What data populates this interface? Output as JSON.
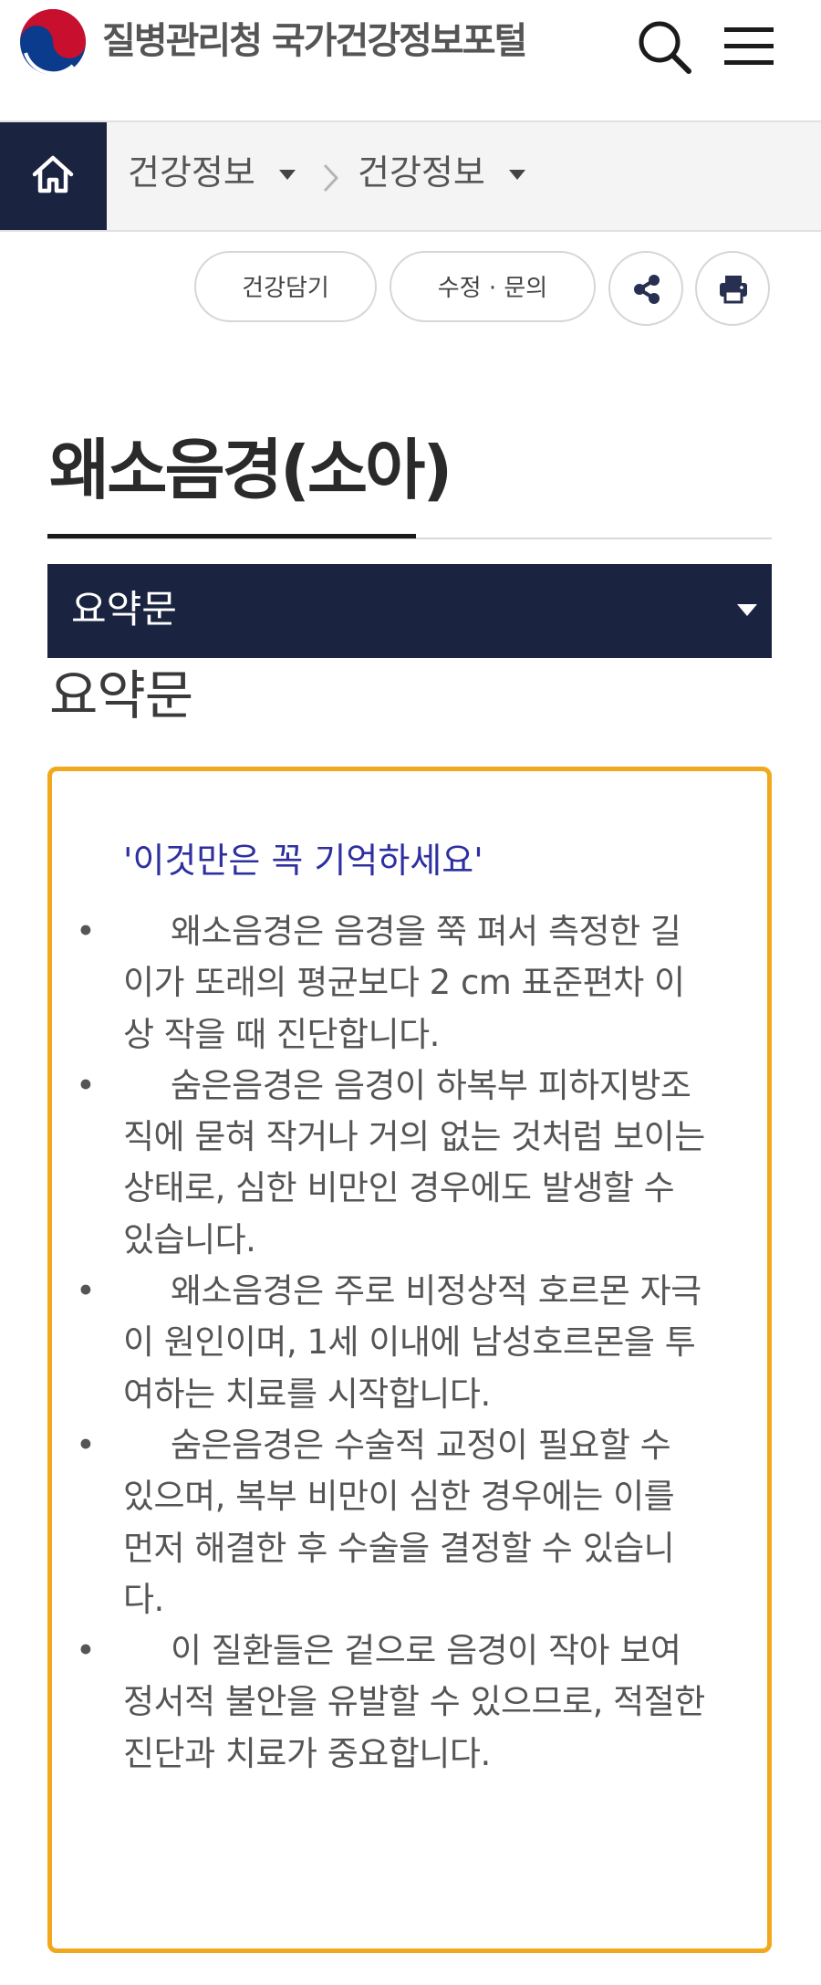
{
  "header": {
    "site_name": "질병관리청 국가건강정보포털",
    "brand_colors": {
      "taeguk_red": "#c8102e",
      "taeguk_blue": "#0b3b8c"
    },
    "icons": [
      "taeguk-logo-icon",
      "search-icon",
      "hamburger-menu-icon"
    ]
  },
  "breadcrumb": {
    "home_icon": "home-icon",
    "items": [
      {
        "label": "건강정보"
      },
      {
        "label": "건강정보"
      }
    ]
  },
  "actions": {
    "save_label": "건강담기",
    "feedback_label": "수정 · 문의",
    "share_icon": "share-icon",
    "print_icon": "print-icon"
  },
  "page": {
    "title": "왜소음경(소아)",
    "accordion_label": "요약문",
    "section_heading": "요약문"
  },
  "summary": {
    "heading": "'이것만은 꼭 기억하세요'",
    "bullet_symbol": "•",
    "items": [
      "왜소음경은 음경을 쭉 펴서 측정한 길이가 또래의 평균보다 2 cm 표준편차 이상 작을 때 진단합니다.",
      "숨은음경은 음경이 하복부 피하지방조직에 묻혀 작거나 거의 없는 것처럼 보이는 상태로, 심한 비만인 경우에도 발생할 수 있습니다.",
      "왜소음경은 주로 비정상적 호르몬 자극이 원인이며, 1세 이내에 남성호르몬을 투여하는 치료를 시작합니다.",
      "숨은음경은 수술적 교정이 필요할 수 있으며, 복부 비만이 심한 경우에는 이를 먼저 해결한 후 수술을 결정할 수 있습니다.",
      "이 질환들은 겉으로 음경이 작아 보여 정서적 불안을 유발할 수 있으므로, 적절한 진단과 치료가 중요합니다."
    ]
  },
  "colors": {
    "navy": "#1a2340",
    "highlight_border": "#f2a81d",
    "summary_heading": "#2e2fa0"
  }
}
